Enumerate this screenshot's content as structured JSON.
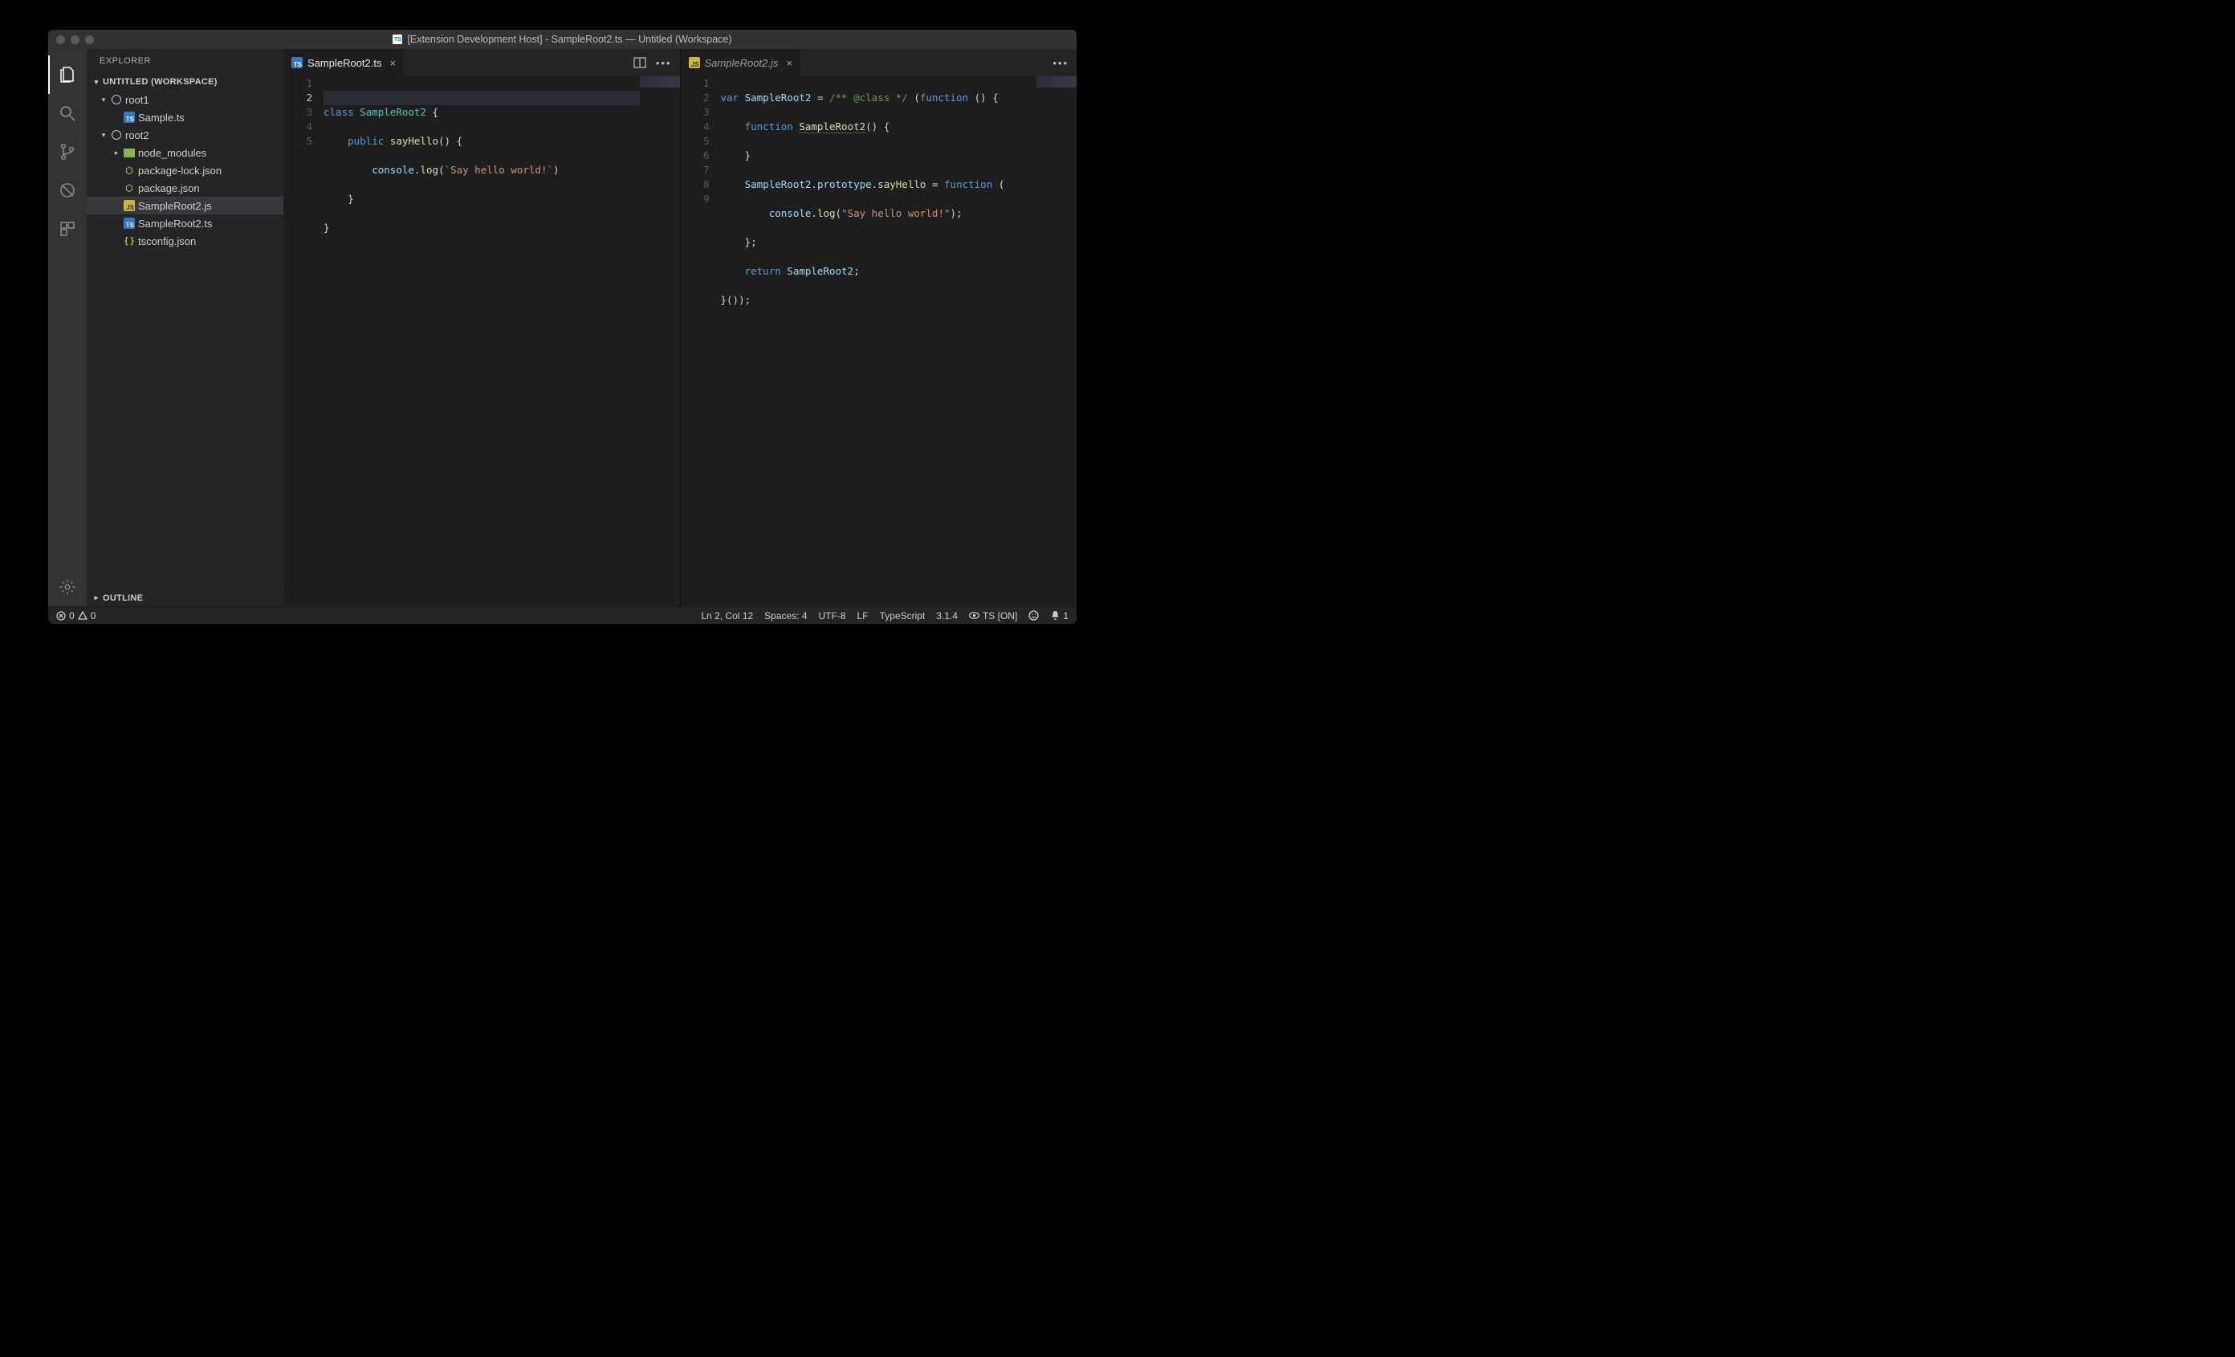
{
  "title": "[Extension Development Host] - SampleRoot2.ts — Untitled (Workspace)",
  "sidebar": {
    "header": "EXPLORER",
    "workspace": "UNTITLED (WORKSPACE)",
    "outline": "OUTLINE",
    "tree": {
      "root1": "root1",
      "root1_items": [
        "Sample.ts"
      ],
      "root2": "root2",
      "root2_items": [
        "node_modules",
        "package-lock.json",
        "package.json",
        "SampleRoot2.js",
        "SampleRoot2.ts",
        "tsconfig.json"
      ]
    }
  },
  "tabs": {
    "left": "SampleRoot2.ts",
    "right": "SampleRoot2.js"
  },
  "editor_left": {
    "lines": [
      "1",
      "2",
      "3",
      "4",
      "5"
    ],
    "code": [
      "class SampleRoot2 {",
      "    public sayHello() {",
      "        console.log(`Say hello world!`)",
      "    }",
      "}"
    ]
  },
  "editor_right": {
    "lines": [
      "1",
      "2",
      "3",
      "4",
      "5",
      "6",
      "7",
      "8",
      "9"
    ],
    "code": [
      "var SampleRoot2 = /** @class */ (function () {",
      "    function SampleRoot2() {",
      "    }",
      "    SampleRoot2.prototype.sayHello = function (",
      "        console.log(\"Say hello world!\");",
      "    };",
      "    return SampleRoot2;",
      "}());",
      ""
    ]
  },
  "status": {
    "errors": "0",
    "warnings": "0",
    "lncol": "Ln 2, Col 12",
    "spaces": "Spaces: 4",
    "encoding": "UTF-8",
    "eol": "LF",
    "lang": "TypeScript",
    "ver": "3.1.4",
    "tsstatus": "TS [ON]",
    "bell": "1"
  }
}
